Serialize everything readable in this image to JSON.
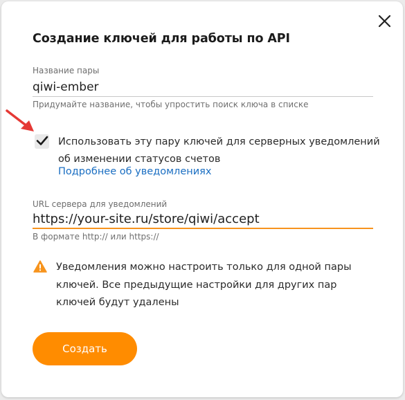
{
  "dialog": {
    "title": "Создание ключей для работы по API",
    "close_icon": "close-icon",
    "pair_name": {
      "label": "Название пары",
      "value": "qiwi-ember",
      "hint": "Придумайте название, чтобы упростить поиск ключа в списке"
    },
    "notifications_checkbox": {
      "checked": true,
      "label": "Использовать эту пару ключей для серверных уведомлений об изменении статусов счетов",
      "link": "Подробнее об уведомлениях"
    },
    "server_url": {
      "label": "URL сервера для уведомлений",
      "value": "https://your-site.ru/store/qiwi/accept",
      "hint": "В формате http:// или https://"
    },
    "warning": {
      "icon": "warning-icon",
      "text": "Уведомления можно настроить только для одной пары ключей. Все предыдущие настройки для других пар ключей будут удалены"
    },
    "create_button": "Создать"
  },
  "annotation": {
    "icon": "red-arrow-icon"
  },
  "colors": {
    "accent": "#ff8c00",
    "field_focus": "#f7931e",
    "link": "#1a6ec2",
    "warning": "#f7941d",
    "annotation_arrow": "#e53935"
  }
}
